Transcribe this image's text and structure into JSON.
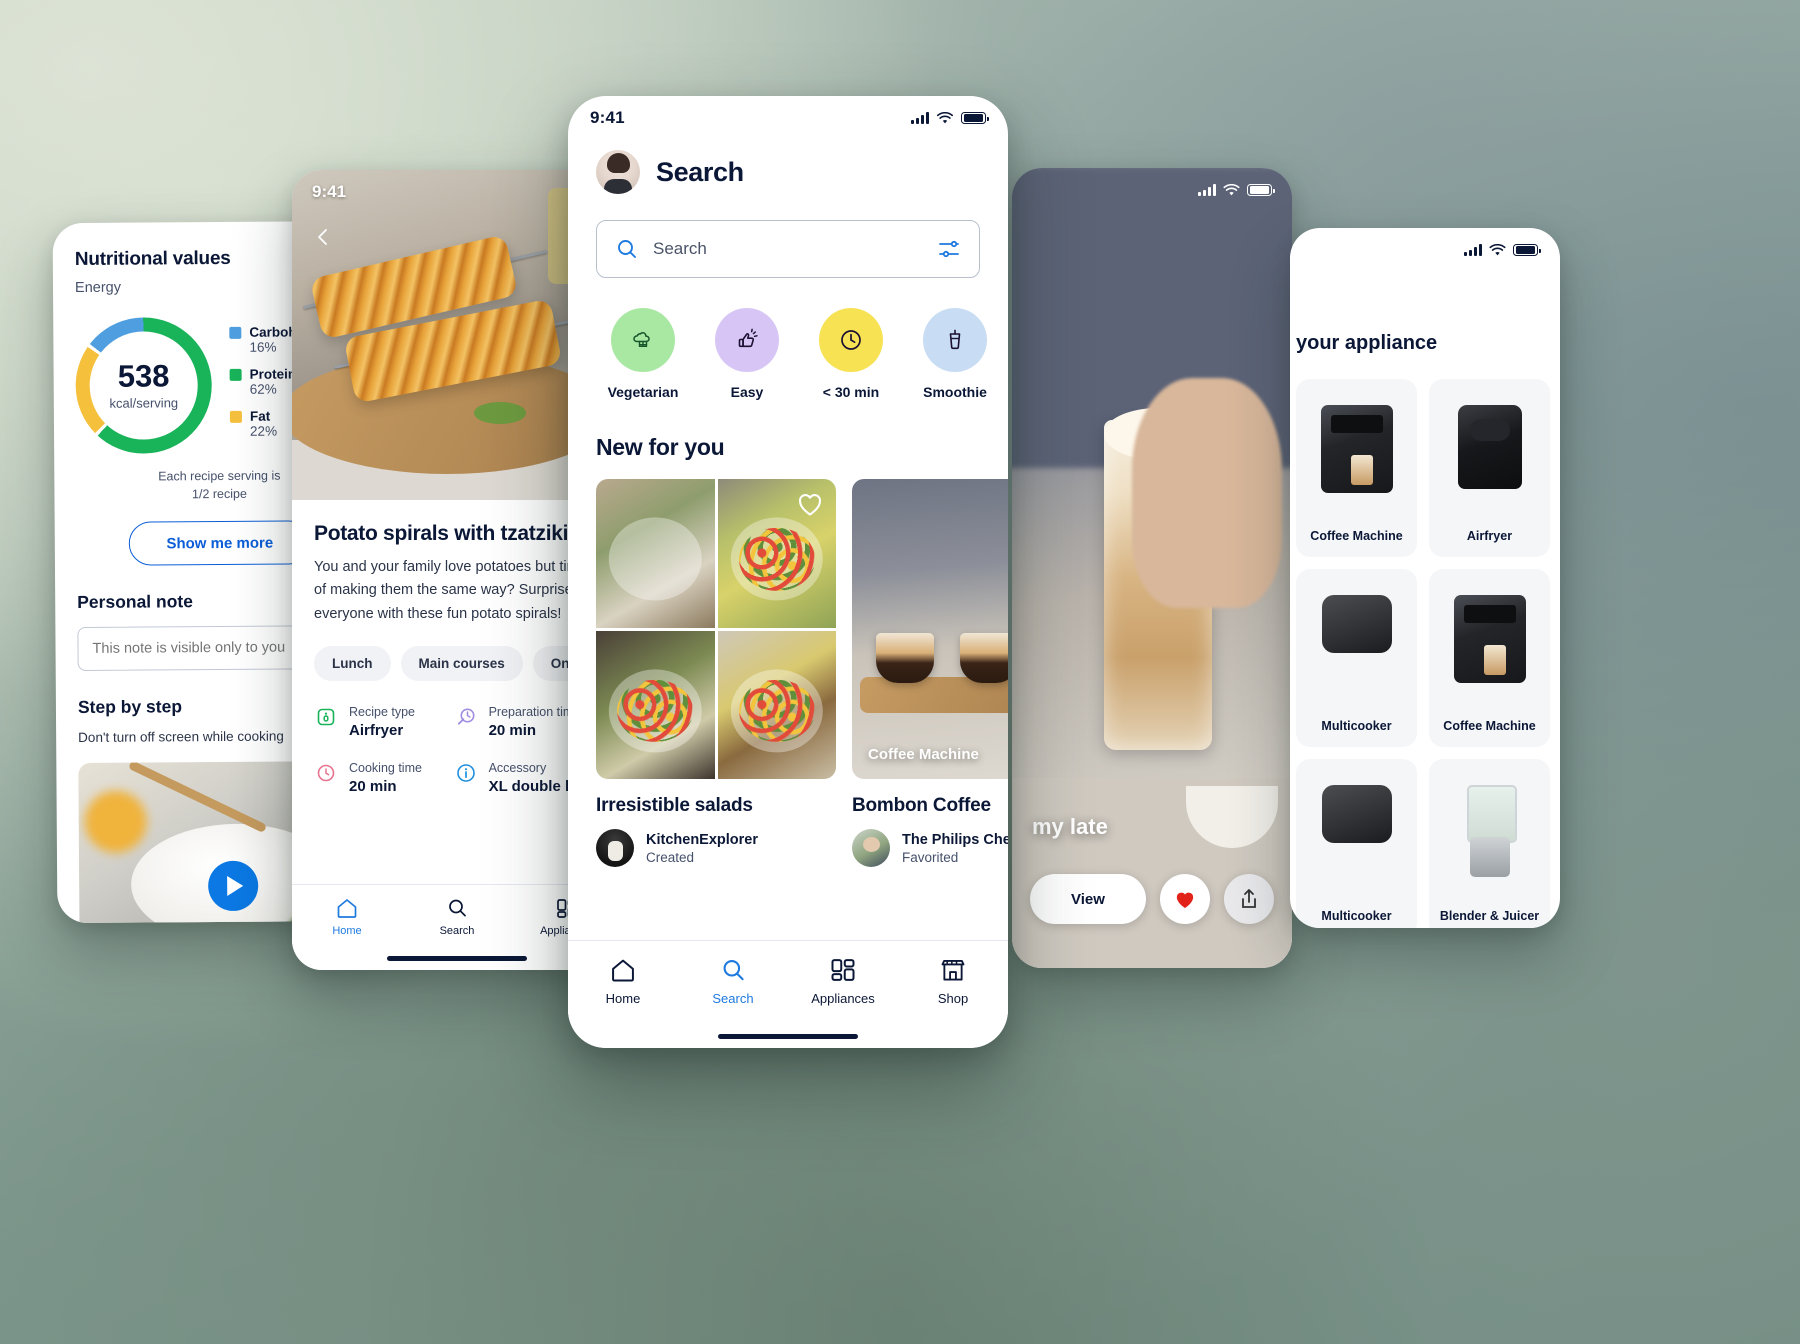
{
  "phone_nutrition": {
    "title": "Nutritional values",
    "energy_label": "Energy",
    "kcal_value": "538",
    "kcal_unit": "kcal/serving",
    "legend": [
      {
        "name": "Carbohydrates",
        "value": "16%",
        "color": "#4f9fe0"
      },
      {
        "name": "Protein",
        "value": "62%",
        "color": "#19b35a"
      },
      {
        "name": "Fat",
        "value": "22%",
        "color": "#f5c13d"
      }
    ],
    "serving_note_line1": "Each recipe serving is",
    "serving_note_line2": "1/2 recipe",
    "show_more_label": "Show me more",
    "personal_note_heading": "Personal note",
    "personal_note_placeholder": "This note is visible only to you",
    "step_by_step_heading": "Step by step",
    "step_by_step_warning": "Don't turn off screen while cooking"
  },
  "phone_recipe": {
    "status_time": "9:41",
    "title": "Potato spirals with tzatziki",
    "description": "You and your family love potatoes but tired of making them the same way? Surprise everyone with these fun potato spirals!",
    "chips": [
      "Lunch",
      "Main courses",
      "One pan"
    ],
    "info": [
      {
        "label": "Recipe type",
        "value": "Airfryer"
      },
      {
        "label": "Preparation time",
        "value": "20 min"
      },
      {
        "label": "Cooking time",
        "value": "20 min"
      },
      {
        "label": "Accessory",
        "value": "XL double layer"
      }
    ],
    "tabs": [
      {
        "label": "Home",
        "icon": "home-icon",
        "active": true
      },
      {
        "label": "Search",
        "icon": "search-icon",
        "active": false
      },
      {
        "label": "Appliances",
        "icon": "appliances-icon",
        "active": false
      }
    ]
  },
  "phone_search": {
    "status_time": "9:41",
    "header_title": "Search",
    "search_placeholder": "Search",
    "filters": [
      {
        "label": "Vegetarian",
        "icon": "broccoli-icon",
        "color": "#a9e8a2"
      },
      {
        "label": "Easy",
        "icon": "thumbs-up-icon",
        "color": "#d7c6f5"
      },
      {
        "label": "< 30 min",
        "icon": "clock-icon",
        "color": "#f7e254"
      },
      {
        "label": "Smoothie",
        "icon": "smoothie-icon",
        "color": "#c8dcf3"
      }
    ],
    "section_title": "New for you",
    "cards": [
      {
        "title": "Irresistible salads",
        "author_name": "KitchenExplorer",
        "author_action": "Created",
        "favorited": false
      },
      {
        "title": "Bombon Coffee",
        "caption": "Coffee Machine",
        "author_name": "The Philips Chef",
        "author_action": "Favorited",
        "favorited": true
      }
    ],
    "tabs": [
      {
        "label": "Home",
        "icon": "home-icon",
        "active": false
      },
      {
        "label": "Search",
        "icon": "search-icon",
        "active": true
      },
      {
        "label": "Appliances",
        "icon": "appliances-icon",
        "active": false
      },
      {
        "label": "Shop",
        "icon": "shop-icon",
        "active": false
      }
    ]
  },
  "phone_video": {
    "overlay_text": "my late",
    "view_label": "View",
    "like_icon": "heart-filled-icon",
    "share_icon": "share-icon"
  },
  "phone_appliances": {
    "heading": "your appliance",
    "items": [
      {
        "label": "Coffee Machine",
        "icon": "coffee-machine-icon"
      },
      {
        "label": "Airfryer",
        "icon": "airfryer-icon"
      },
      {
        "label": "Multicooker",
        "icon": "cooker-icon"
      },
      {
        "label": "Coffee Machine",
        "icon": "coffee-machine-icon"
      },
      {
        "label": "Multicooker",
        "icon": "cooker-icon"
      },
      {
        "label": "Blender & Juicer",
        "icon": "blender-icon"
      }
    ]
  },
  "colors": {
    "accent_blue": "#1f7ae0",
    "link_blue": "#0b5ed7",
    "ink": "#0b1736",
    "muted": "#45506b",
    "like_red": "#e2231a"
  }
}
